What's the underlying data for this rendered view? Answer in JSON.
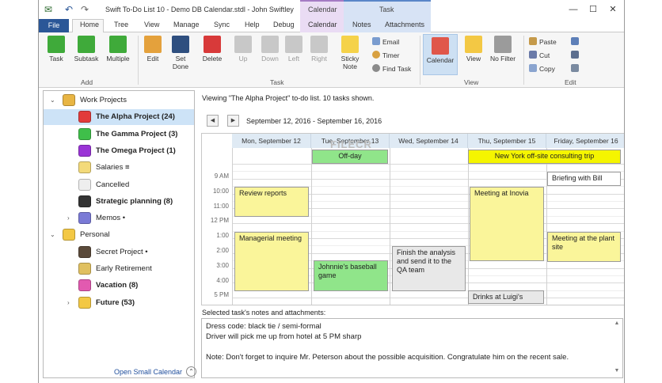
{
  "window": {
    "title": "Swift To-Do List 10 - Demo DB Calendar.stdl - John Swiftley",
    "context_calendar": "Calendar",
    "context_task": "Task",
    "controls": {
      "minimize": "—",
      "maximize": "☐",
      "close": "✕"
    }
  },
  "tabs": {
    "file": "File",
    "items": [
      "Home",
      "Tree",
      "View",
      "Manage",
      "Sync",
      "Help",
      "Debug",
      "Calendar",
      "Notes",
      "Attachments"
    ]
  },
  "ribbon": {
    "add_group": "Add",
    "task_group": "Task",
    "view_group": "View",
    "edit_group": "Edit",
    "buttons": {
      "task": "Task",
      "subtask": "Subtask",
      "multiple": "Multiple",
      "edit": "Edit",
      "set_done_1": "Set",
      "set_done_2": "Done",
      "delete": "Delete",
      "up": "Up",
      "down": "Down",
      "left": "Left",
      "right": "Right",
      "sticky_1": "Sticky",
      "sticky_2": "Note",
      "email": "Email",
      "timer": "Timer",
      "find_task": "Find Task",
      "calendar": "Calendar",
      "view": "View",
      "no_filter": "No Filter",
      "paste": "Paste",
      "cut": "Cut",
      "copy": "Copy"
    }
  },
  "tree": {
    "items": [
      {
        "label": "Work Projects",
        "bold": false,
        "icon_color": "#e8b544",
        "twisty": "⌄"
      },
      {
        "label": "The Alpha Project (24)",
        "bold": true,
        "icon_color": "#e23b3b",
        "twisty": ""
      },
      {
        "label": "The Gamma Project (3)",
        "bold": true,
        "icon_color": "#3fbf4a",
        "twisty": ""
      },
      {
        "label": "The Omega Project (1)",
        "bold": true,
        "icon_color": "#9a34d6",
        "twisty": ""
      },
      {
        "label": "Salaries ≡",
        "bold": false,
        "icon_color": "#f3da7a",
        "twisty": ""
      },
      {
        "label": "Cancelled",
        "bold": false,
        "icon_color": "#eeeeee",
        "twisty": ""
      },
      {
        "label": "Strategic planning (8)",
        "bold": true,
        "icon_color": "#333333",
        "twisty": ""
      },
      {
        "label": "Memos •",
        "bold": false,
        "icon_color": "#7a7ad6",
        "twisty": "›"
      },
      {
        "label": "Personal",
        "bold": false,
        "icon_color": "#f3c844",
        "twisty": "⌄"
      },
      {
        "label": "Secret Project •",
        "bold": false,
        "icon_color": "#5b4a3a",
        "twisty": ""
      },
      {
        "label": "Early Retirement",
        "bold": false,
        "icon_color": "#e0c060",
        "twisty": ""
      },
      {
        "label": "Vacation (8)",
        "bold": true,
        "icon_color": "#e25ab0",
        "twisty": ""
      },
      {
        "label": "Future (53)",
        "bold": true,
        "icon_color": "#f3c844",
        "twisty": "›"
      }
    ],
    "open_small_calendar": "Open Small Calendar",
    "open_small_calendar_btn": "⌃"
  },
  "main": {
    "viewing": "Viewing \"The Alpha Project\" to-do list. 10 tasks shown.",
    "prev": "◀",
    "next": "▶",
    "date_range": "September 12, 2016 - September 16, 2016",
    "days": [
      "Mon, September 12",
      "Tue, September 13",
      "Wed, September 14",
      "Thu, September 15",
      "Friday, September 16"
    ],
    "times": [
      "9 AM",
      "10:00",
      "11:00",
      "12 PM",
      "1:00",
      "2:00",
      "3:00",
      "4:00",
      "5 PM"
    ],
    "watermark": "FILECR",
    "appointments": [
      {
        "text": "Off-day",
        "color": "#90e58a"
      },
      {
        "text": "New York off-site consulting trip",
        "color": "#f5f500"
      },
      {
        "text": "Briefing with Bill",
        "color": "#ffffff"
      },
      {
        "text": "Review reports",
        "color": "#faf59a"
      },
      {
        "text": "Meeting at Inovia",
        "color": "#faf59a"
      },
      {
        "text": "Managerial meeting",
        "color": "#faf59a"
      },
      {
        "text": "Johnnie's baseball game",
        "color": "#90e58a"
      },
      {
        "text": "Finish the analysis and send it to the QA team",
        "color": "#e8e8e8"
      },
      {
        "text": "Meeting at the plant site",
        "color": "#faf59a"
      },
      {
        "text": "Drinks at Luigi's",
        "color": "#e8e8e8"
      }
    ],
    "notes_title": "Selected task's notes and attachments:",
    "notes_lines": [
      "Dress code: black tie / semi-formal",
      "Driver will pick me up from hotel at 5 PM sharp",
      "",
      "Note: Don't forget to inquire Mr. Peterson about the possible acquisition. Congratulate him on the recent sale."
    ]
  }
}
